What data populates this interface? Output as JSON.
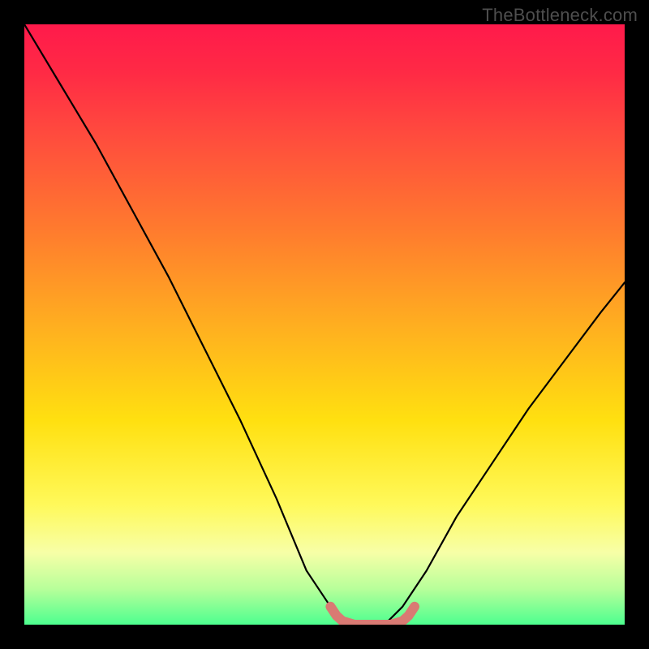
{
  "watermark": "TheBottleneck.com",
  "chart_data": {
    "type": "line",
    "title": "",
    "xlabel": "",
    "ylabel": "",
    "xlim": [
      0,
      1
    ],
    "ylim": [
      0,
      1
    ],
    "series": [
      {
        "name": "bottleneck-curve",
        "x": [
          0.0,
          0.06,
          0.12,
          0.18,
          0.24,
          0.3,
          0.36,
          0.42,
          0.47,
          0.51,
          0.54,
          0.57,
          0.6,
          0.63,
          0.67,
          0.72,
          0.78,
          0.84,
          0.9,
          0.96,
          1.0
        ],
        "y": [
          1.0,
          0.9,
          0.8,
          0.69,
          0.58,
          0.46,
          0.34,
          0.21,
          0.09,
          0.03,
          0.0,
          0.0,
          0.0,
          0.03,
          0.09,
          0.18,
          0.27,
          0.36,
          0.44,
          0.52,
          0.57
        ],
        "color": "#000000"
      },
      {
        "name": "optimal-zone-marker",
        "x": [
          0.51,
          0.52,
          0.53,
          0.55,
          0.58,
          0.61,
          0.63,
          0.64,
          0.65
        ],
        "y": [
          0.03,
          0.015,
          0.006,
          0.0,
          0.0,
          0.0,
          0.006,
          0.015,
          0.03
        ],
        "color": "#d97a73"
      }
    ],
    "gradient_stops": [
      {
        "pos": 0.0,
        "color": "#ff1a4b"
      },
      {
        "pos": 0.08,
        "color": "#ff2a45"
      },
      {
        "pos": 0.18,
        "color": "#ff4a3e"
      },
      {
        "pos": 0.34,
        "color": "#ff7a2e"
      },
      {
        "pos": 0.5,
        "color": "#ffae20"
      },
      {
        "pos": 0.66,
        "color": "#ffe010"
      },
      {
        "pos": 0.8,
        "color": "#fff95a"
      },
      {
        "pos": 0.88,
        "color": "#f7ffa7"
      },
      {
        "pos": 0.94,
        "color": "#b8ff9a"
      },
      {
        "pos": 1.0,
        "color": "#4dff8f"
      }
    ]
  }
}
